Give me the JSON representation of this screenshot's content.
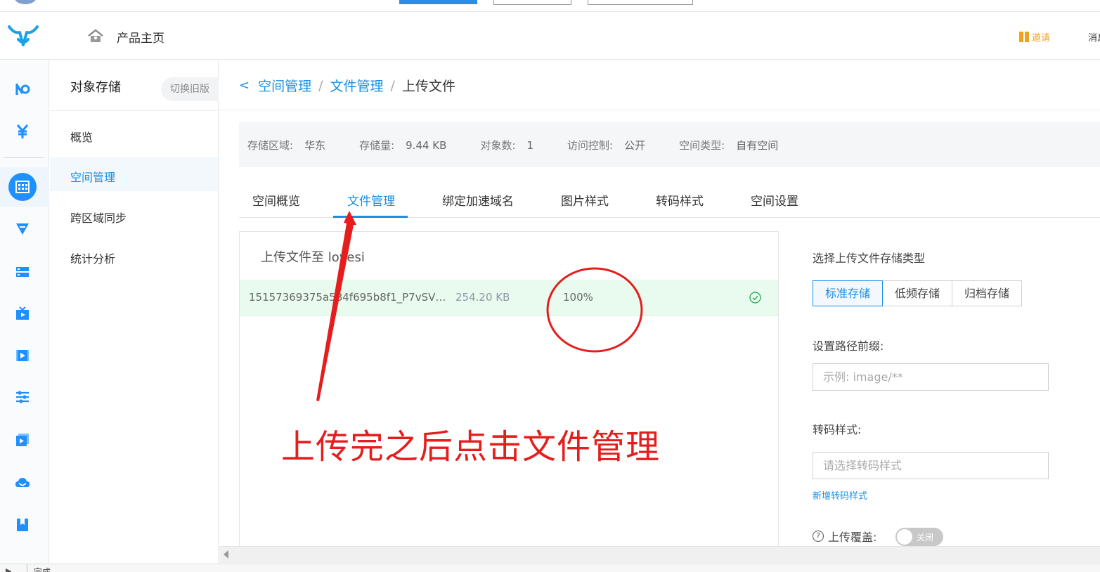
{
  "header": {
    "home_label": "产品主页",
    "invite_label": "邀请",
    "message_label": "消息"
  },
  "subnav": {
    "title": "对象存储",
    "switch_label": "切换旧版",
    "items": [
      {
        "label": "概览"
      },
      {
        "label": "空间管理"
      },
      {
        "label": "跨区域同步"
      },
      {
        "label": "统计分析"
      }
    ]
  },
  "breadcrumb": {
    "back": "<",
    "items": [
      "空间管理",
      "文件管理",
      "上传文件"
    ],
    "separator": "/"
  },
  "info": {
    "region_label": "存储区域:",
    "region_value": "华东",
    "storage_label": "存储量:",
    "storage_value": "9.44 KB",
    "objects_label": "对象数:",
    "objects_value": "1",
    "access_label": "访问控制:",
    "access_value": "公开",
    "type_label": "空间类型:",
    "type_value": "自有空间"
  },
  "tabs": [
    "空间概览",
    "文件管理",
    "绑定加速域名",
    "图片样式",
    "转码样式",
    "空间设置"
  ],
  "upload": {
    "title": "上传文件至 lovesi",
    "file": {
      "name": "15157369375a584f695b8f1_P7vSVV...",
      "size": "254.20 KB",
      "progress": "100%",
      "progress_value": 100
    }
  },
  "settings": {
    "storage_type_label": "选择上传文件存储类型",
    "storage_types": [
      "标准存储",
      "低频存储",
      "归档存储"
    ],
    "selected_storage_type": "标准存储",
    "prefix_label": "设置路径前缀:",
    "prefix_placeholder": "示例: image/**",
    "transcode_label": "转码样式:",
    "transcode_placeholder": "请选择转码样式",
    "add_transcode_link": "新增转码样式",
    "overwrite_label": "上传覆盖:",
    "overwrite_toggle": "关闭"
  },
  "status": {
    "text": "完成"
  },
  "annotation": {
    "text": "上传完之后点击文件管理",
    "color": "#e51d1d"
  },
  "colors": {
    "accent": "#1a8fe3",
    "success_row": "#e8fbee",
    "success_icon": "#2fae5a",
    "invite": "#f0a21c"
  }
}
